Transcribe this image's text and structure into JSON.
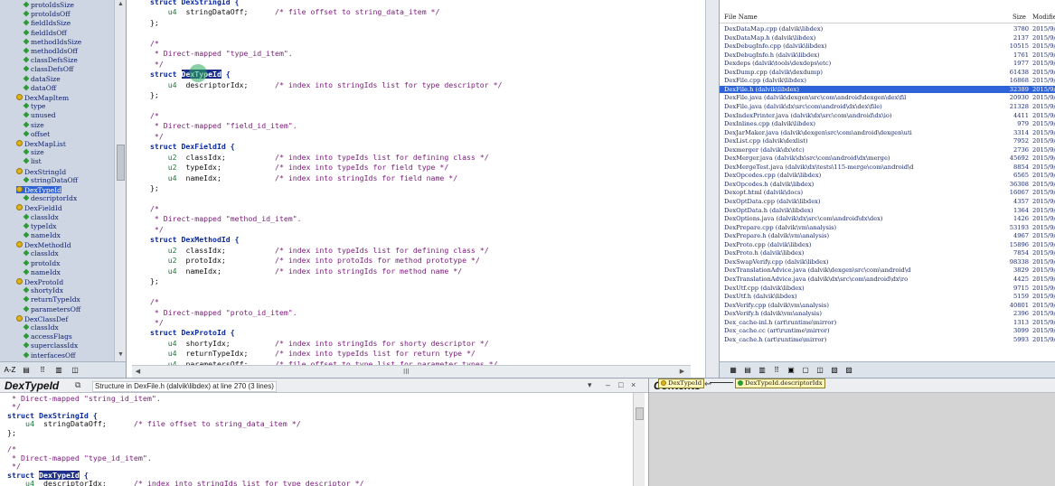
{
  "tree": {
    "items": [
      {
        "label": "protoIdsSize",
        "icon": "field",
        "indent": 1
      },
      {
        "label": "protoIdsOff",
        "icon": "field",
        "indent": 1
      },
      {
        "label": "fieldIdsSize",
        "icon": "field",
        "indent": 1
      },
      {
        "label": "fieldIdsOff",
        "icon": "field",
        "indent": 1
      },
      {
        "label": "methodIdsSize",
        "icon": "field",
        "indent": 1
      },
      {
        "label": "methodIdsOff",
        "icon": "field",
        "indent": 1
      },
      {
        "label": "classDefsSize",
        "icon": "field",
        "indent": 1
      },
      {
        "label": "classDefsOff",
        "icon": "field",
        "indent": 1
      },
      {
        "label": "dataSize",
        "icon": "field",
        "indent": 1
      },
      {
        "label": "dataOff",
        "icon": "field",
        "indent": 1
      },
      {
        "label": "DexMapItem",
        "icon": "struct",
        "indent": 0
      },
      {
        "label": "type",
        "icon": "field",
        "indent": 1
      },
      {
        "label": "unused",
        "icon": "field",
        "indent": 1
      },
      {
        "label": "size",
        "icon": "field",
        "indent": 1
      },
      {
        "label": "offset",
        "icon": "field",
        "indent": 1
      },
      {
        "label": "DexMapList",
        "icon": "struct",
        "indent": 0
      },
      {
        "label": "size",
        "icon": "field",
        "indent": 1
      },
      {
        "label": "list",
        "icon": "field",
        "indent": 1
      },
      {
        "label": "DexStringId",
        "icon": "struct",
        "indent": 0
      },
      {
        "label": "stringDataOff",
        "icon": "field",
        "indent": 1
      },
      {
        "label": "DexTypeId",
        "icon": "struct",
        "indent": 0,
        "selected": true
      },
      {
        "label": "descriptorIdx",
        "icon": "field",
        "indent": 1
      },
      {
        "label": "DexFieldId",
        "icon": "struct",
        "indent": 0
      },
      {
        "label": "classIdx",
        "icon": "field",
        "indent": 1
      },
      {
        "label": "typeIdx",
        "icon": "field",
        "indent": 1
      },
      {
        "label": "nameIdx",
        "icon": "field",
        "indent": 1
      },
      {
        "label": "DexMethodId",
        "icon": "struct",
        "indent": 0
      },
      {
        "label": "classIdx",
        "icon": "field",
        "indent": 1
      },
      {
        "label": "protoIdx",
        "icon": "field",
        "indent": 1
      },
      {
        "label": "nameIdx",
        "icon": "field",
        "indent": 1
      },
      {
        "label": "DexProtoId",
        "icon": "struct",
        "indent": 0
      },
      {
        "label": "shortyIdx",
        "icon": "field",
        "indent": 1
      },
      {
        "label": "returnTypeIdx",
        "icon": "field",
        "indent": 1
      },
      {
        "label": "parametersOff",
        "icon": "field",
        "indent": 1
      },
      {
        "label": "DexClassDef",
        "icon": "struct",
        "indent": 0
      },
      {
        "label": "classIdx",
        "icon": "field",
        "indent": 1
      },
      {
        "label": "accessFlags",
        "icon": "field",
        "indent": 1
      },
      {
        "label": "superclassIdx",
        "icon": "field",
        "indent": 1
      },
      {
        "label": "interfacesOff",
        "icon": "field",
        "indent": 1
      }
    ],
    "toolbar": [
      "A-Z",
      "▤",
      "⠿",
      "▥",
      "◫"
    ]
  },
  "code": {
    "lines": [
      {
        "segs": [
          {
            "t": "struct DexStringId {",
            "c": "kw"
          }
        ]
      },
      {
        "segs": [
          {
            "t": "    u4  ",
            "c": "type"
          },
          {
            "t": "stringDataOff;",
            "c": "plain"
          },
          {
            "t": "      /* file offset to string_data_item */",
            "c": "comment"
          }
        ]
      },
      {
        "segs": [
          {
            "t": "};",
            "c": "plain"
          }
        ]
      },
      {
        "segs": []
      },
      {
        "segs": [
          {
            "t": "/*",
            "c": "comment"
          }
        ]
      },
      {
        "segs": [
          {
            "t": " * Direct-mapped \"type_id_item\".",
            "c": "comment"
          }
        ]
      },
      {
        "segs": [
          {
            "t": " */",
            "c": "comment"
          }
        ]
      },
      {
        "segs": [
          {
            "t": "struct ",
            "c": "kw"
          },
          {
            "t": "DexTypeId",
            "c": "hl"
          },
          {
            "t": " {",
            "c": "kw"
          }
        ]
      },
      {
        "segs": [
          {
            "t": "    u4  ",
            "c": "type"
          },
          {
            "t": "descriptorIdx;",
            "c": "plain"
          },
          {
            "t": "      /* index into stringIds list for type descriptor */",
            "c": "comment"
          }
        ]
      },
      {
        "segs": [
          {
            "t": "};",
            "c": "plain"
          }
        ]
      },
      {
        "segs": []
      },
      {
        "segs": [
          {
            "t": "/*",
            "c": "comment"
          }
        ]
      },
      {
        "segs": [
          {
            "t": " * Direct-mapped \"field_id_item\".",
            "c": "comment"
          }
        ]
      },
      {
        "segs": [
          {
            "t": " */",
            "c": "comment"
          }
        ]
      },
      {
        "segs": [
          {
            "t": "struct DexFieldId {",
            "c": "kw"
          }
        ]
      },
      {
        "segs": [
          {
            "t": "    u2  ",
            "c": "type"
          },
          {
            "t": "classIdx;",
            "c": "plain"
          },
          {
            "t": "           /* index into typeIds list for defining class */",
            "c": "comment"
          }
        ]
      },
      {
        "segs": [
          {
            "t": "    u2  ",
            "c": "type"
          },
          {
            "t": "typeIdx;",
            "c": "plain"
          },
          {
            "t": "            /* index into typeIds for field type */",
            "c": "comment"
          }
        ]
      },
      {
        "segs": [
          {
            "t": "    u4  ",
            "c": "type"
          },
          {
            "t": "nameIdx;",
            "c": "plain"
          },
          {
            "t": "            /* index into stringIds for field name */",
            "c": "comment"
          }
        ]
      },
      {
        "segs": [
          {
            "t": "};",
            "c": "plain"
          }
        ]
      },
      {
        "segs": []
      },
      {
        "segs": [
          {
            "t": "/*",
            "c": "comment"
          }
        ]
      },
      {
        "segs": [
          {
            "t": " * Direct-mapped \"method_id_item\".",
            "c": "comment"
          }
        ]
      },
      {
        "segs": [
          {
            "t": " */",
            "c": "comment"
          }
        ]
      },
      {
        "segs": [
          {
            "t": "struct DexMethodId {",
            "c": "kw"
          }
        ]
      },
      {
        "segs": [
          {
            "t": "    u2  ",
            "c": "type"
          },
          {
            "t": "classIdx;",
            "c": "plain"
          },
          {
            "t": "           /* index into typeIds list for defining class */",
            "c": "comment"
          }
        ]
      },
      {
        "segs": [
          {
            "t": "    u2  ",
            "c": "type"
          },
          {
            "t": "protoIdx;",
            "c": "plain"
          },
          {
            "t": "           /* index into protoIds for method prototype */",
            "c": "comment"
          }
        ]
      },
      {
        "segs": [
          {
            "t": "    u4  ",
            "c": "type"
          },
          {
            "t": "nameIdx;",
            "c": "plain"
          },
          {
            "t": "            /* index into stringIds for method name */",
            "c": "comment"
          }
        ]
      },
      {
        "segs": [
          {
            "t": "};",
            "c": "plain"
          }
        ]
      },
      {
        "segs": []
      },
      {
        "segs": [
          {
            "t": "/*",
            "c": "comment"
          }
        ]
      },
      {
        "segs": [
          {
            "t": " * Direct-mapped \"proto_id_item\".",
            "c": "comment"
          }
        ]
      },
      {
        "segs": [
          {
            "t": " */",
            "c": "comment"
          }
        ]
      },
      {
        "segs": [
          {
            "t": "struct DexProtoId {",
            "c": "kw"
          }
        ]
      },
      {
        "segs": [
          {
            "t": "    u4  ",
            "c": "type"
          },
          {
            "t": "shortyIdx;",
            "c": "plain"
          },
          {
            "t": "          /* index into stringIds for shorty descriptor */",
            "c": "comment"
          }
        ]
      },
      {
        "segs": [
          {
            "t": "    u4  ",
            "c": "type"
          },
          {
            "t": "returnTypeIdx;",
            "c": "plain"
          },
          {
            "t": "      /* index into typeIds list for return type */",
            "c": "comment"
          }
        ]
      },
      {
        "segs": [
          {
            "t": "    u4  ",
            "c": "type"
          },
          {
            "t": "parametersOff;",
            "c": "plain"
          },
          {
            "t": "      /* file offset to type_list for parameter types */",
            "c": "comment"
          }
        ]
      },
      {
        "segs": [
          {
            "t": "};",
            "c": "plain"
          }
        ]
      }
    ],
    "hscroll_mid": "III"
  },
  "files": {
    "headers": {
      "name": "File Name",
      "size": "Size",
      "modified": "Modifie"
    },
    "rows": [
      {
        "name": "DexDataMap.cpp (dalvik\\libdex)",
        "size": "3780",
        "mod": "2015/9/"
      },
      {
        "name": "DexDataMap.h (dalvik\\libdex)",
        "size": "2137",
        "mod": "2015/9/"
      },
      {
        "name": "DexDebugInfo.cpp (dalvik\\libdex)",
        "size": "10515",
        "mod": "2015/9/"
      },
      {
        "name": "DexDebugInfo.h (dalvik\\libdex)",
        "size": "1761",
        "mod": "2015/9/"
      },
      {
        "name": "Dexdeps (dalvik\\tools\\dexdeps\\etc)",
        "size": "1977",
        "mod": "2015/9/"
      },
      {
        "name": "DexDump.cpp (dalvik\\dexdump)",
        "size": "61438",
        "mod": "2015/9/"
      },
      {
        "name": "DexFile.cpp (dalvik\\libdex)",
        "size": "16868",
        "mod": "2015/9/"
      },
      {
        "name": "DexFile.h (dalvik\\libdex)",
        "size": "32389",
        "mod": "2015/9/",
        "selected": true
      },
      {
        "name": "DexFile.java (dalvik\\dexgen\\src\\com\\android\\dexgen\\dex\\fil",
        "size": "20930",
        "mod": "2015/9/"
      },
      {
        "name": "DexFile.java (dalvik\\dx\\src\\com\\android\\dx\\dex\\file)",
        "size": "21328",
        "mod": "2015/9/"
      },
      {
        "name": "DexIndexPrinter.java (dalvik\\dx\\src\\com\\android\\dx\\io)",
        "size": "4411",
        "mod": "2015/9/"
      },
      {
        "name": "DexInlines.cpp (dalvik\\libdex)",
        "size": "979",
        "mod": "2015/9/"
      },
      {
        "name": "DexJarMaker.java (dalvik\\dexgen\\src\\com\\android\\dexgen\\uti",
        "size": "3314",
        "mod": "2015/9/"
      },
      {
        "name": "DexList.cpp (dalvik\\dexlist)",
        "size": "7952",
        "mod": "2015/9/"
      },
      {
        "name": "Dexmerger (dalvik\\dx\\etc)",
        "size": "2736",
        "mod": "2015/9/"
      },
      {
        "name": "DexMerger.java (dalvik\\dx\\src\\com\\android\\dx\\merge)",
        "size": "45692",
        "mod": "2015/9/"
      },
      {
        "name": "DexMergeTest.java (dalvik\\dx\\tests\\115-merge\\com\\android\\d",
        "size": "8854",
        "mod": "2015/9/"
      },
      {
        "name": "DexOpcodes.cpp (dalvik\\libdex)",
        "size": "6565",
        "mod": "2015/9/"
      },
      {
        "name": "DexOpcodes.h (dalvik\\libdex)",
        "size": "36308",
        "mod": "2015/9/"
      },
      {
        "name": "Dexopt.html (dalvik\\docs)",
        "size": "16067",
        "mod": "2015/9/"
      },
      {
        "name": "DexOptData.cpp (dalvik\\libdex)",
        "size": "4357",
        "mod": "2015/9/"
      },
      {
        "name": "DexOptData.h (dalvik\\libdex)",
        "size": "1364",
        "mod": "2015/9/"
      },
      {
        "name": "DexOptions.java (dalvik\\dx\\src\\com\\android\\dx\\dex)",
        "size": "1426",
        "mod": "2015/9/"
      },
      {
        "name": "DexPrepare.cpp (dalvik\\vm\\analysis)",
        "size": "53193",
        "mod": "2015/9/"
      },
      {
        "name": "DexPrepare.h (dalvik\\vm\\analysis)",
        "size": "4967",
        "mod": "2015/9/"
      },
      {
        "name": "DexProto.cpp (dalvik\\libdex)",
        "size": "15896",
        "mod": "2015/9/"
      },
      {
        "name": "DexProto.h (dalvik\\libdex)",
        "size": "7854",
        "mod": "2015/9/"
      },
      {
        "name": "DexSwapVerify.cpp (dalvik\\libdex)",
        "size": "98338",
        "mod": "2015/9/"
      },
      {
        "name": "DexTranslationAdvice.java (dalvik\\dexgen\\src\\com\\android\\d",
        "size": "3829",
        "mod": "2015/9/"
      },
      {
        "name": "DexTranslationAdvice.java (dalvik\\dx\\src\\com\\android\\dx\\ro",
        "size": "4425",
        "mod": "2015/9/"
      },
      {
        "name": "DexUtf.cpp (dalvik\\libdex)",
        "size": "9715",
        "mod": "2015/9/"
      },
      {
        "name": "DexUtf.h (dalvik\\libdex)",
        "size": "5159",
        "mod": "2015/9/"
      },
      {
        "name": "DexVerify.cpp (dalvik\\vm\\analysis)",
        "size": "40801",
        "mod": "2015/9/"
      },
      {
        "name": "DexVerify.h (dalvik\\vm\\analysis)",
        "size": "2396",
        "mod": "2015/9/"
      },
      {
        "name": "Dex_cache-inl.h (art\\runtime\\mirror)",
        "size": "1313",
        "mod": "2015/9/"
      },
      {
        "name": "Dex_cache.cc (art\\runtime\\mirror)",
        "size": "3099",
        "mod": "2015/9/"
      },
      {
        "name": "Dex_cache.h (art\\runtime\\mirror)",
        "size": "5993",
        "mod": "2015/9/"
      }
    ],
    "toolbar": [
      "▦",
      "▤",
      "▥",
      "⠿",
      "▣",
      "▢",
      "◫",
      "▧",
      "▨"
    ]
  },
  "context": {
    "symbol": "DexTypeId",
    "info": "Structure in DexFile.h (dalvik\\libdex) at line 270 (3 lines)",
    "buttons": [
      "⧉",
      "▾",
      "–",
      "□",
      "×"
    ],
    "lines": [
      {
        "segs": [
          {
            "t": " * Direct-mapped \"string_id_item\".",
            "c": "comment"
          }
        ]
      },
      {
        "segs": [
          {
            "t": " */",
            "c": "comment"
          }
        ]
      },
      {
        "segs": [
          {
            "t": "struct DexStringId {",
            "c": "kw"
          }
        ]
      },
      {
        "segs": [
          {
            "t": "    u4  ",
            "c": "type"
          },
          {
            "t": "stringDataOff;",
            "c": "plain"
          },
          {
            "t": "      /* file offset to string_data_item */",
            "c": "comment"
          }
        ]
      },
      {
        "segs": [
          {
            "t": "};",
            "c": "plain"
          }
        ]
      },
      {
        "segs": []
      },
      {
        "segs": [
          {
            "t": "/*",
            "c": "comment"
          }
        ]
      },
      {
        "segs": [
          {
            "t": " * Direct-mapped \"type_id_item\".",
            "c": "comment"
          }
        ]
      },
      {
        "segs": [
          {
            "t": " */",
            "c": "comment"
          }
        ]
      },
      {
        "segs": [
          {
            "t": "struct ",
            "c": "kw"
          },
          {
            "t": "DexTypeId",
            "c": "hl"
          },
          {
            "t": " {",
            "c": "kw"
          }
        ]
      },
      {
        "segs": [
          {
            "t": "    u4  ",
            "c": "type"
          },
          {
            "t": "descriptorIdx;",
            "c": "plain"
          },
          {
            "t": "      /* index into stringIds list for type descriptor */",
            "c": "comment"
          }
        ]
      },
      {
        "segs": [
          {
            "t": "};",
            "c": "plain"
          }
        ]
      }
    ]
  },
  "contents": {
    "title": "Contents",
    "title_icon": "⇜",
    "node_root": "DexTypeId",
    "node_child": "DexTypeId.descriptorIdx"
  },
  "colors": {
    "tree_bg": "#cdd6e2",
    "selection": "#2f63d8",
    "keyword": "#0a2a9e",
    "comment": "#7a1a79",
    "type": "#1a7a3a",
    "highlight": "#1d2f8a"
  }
}
